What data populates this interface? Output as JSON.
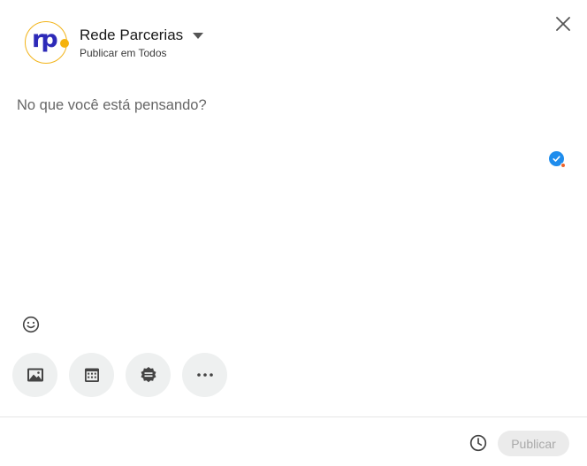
{
  "author": {
    "name": "Rede Parcerias",
    "visibility": "Publicar em Todos",
    "avatar_text": "rp",
    "avatar_colors": {
      "text": "#2d2ab8",
      "dot": "#f5b20b",
      "ring": "#f2b317"
    }
  },
  "editor": {
    "placeholder": "No que você está pensando?"
  },
  "icons": {
    "close": "close-icon",
    "verified": "verified-check-icon",
    "emoji": "emoji-icon",
    "schedule": "clock-icon"
  },
  "tools": [
    {
      "name": "add-media-button",
      "icon": "image-icon"
    },
    {
      "name": "create-event-button",
      "icon": "calendar-icon"
    },
    {
      "name": "celebrate-button",
      "icon": "badge-icon"
    },
    {
      "name": "more-button",
      "icon": "more-icon"
    }
  ],
  "footer": {
    "publish_label": "Publicar"
  },
  "colors": {
    "accent": "#1f8ded",
    "tool_bg": "#eef0f0",
    "publish_disabled_bg": "#ebebeb",
    "publish_disabled_text": "#a9a9a9"
  }
}
